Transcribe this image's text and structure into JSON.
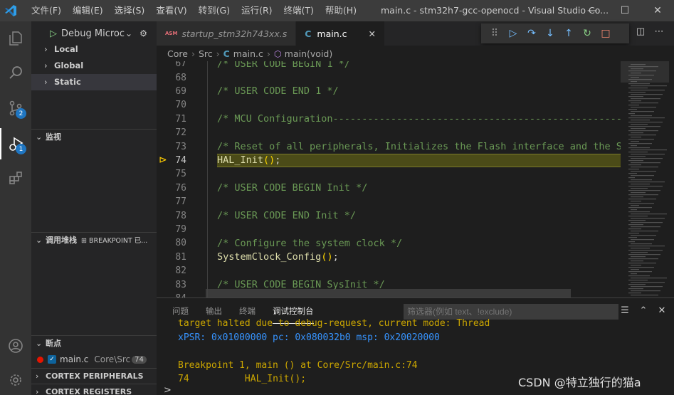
{
  "titlebar": {
    "menu": [
      "文件(F)",
      "编辑(E)",
      "选择(S)",
      "查看(V)",
      "转到(G)",
      "运行(R)",
      "终端(T)",
      "帮助(H)"
    ],
    "title": "main.c - stm32h7-gcc-openocd - Visual Studio Co...",
    "controls": [
      "—",
      "☐",
      "✕"
    ]
  },
  "activity": {
    "scm_badge": "2",
    "debug_badge": "1"
  },
  "sidebar": {
    "debug_config": "Debug Microc",
    "variables": [
      "Local",
      "Global",
      "Static"
    ],
    "watch_header": "监视",
    "callstack_header": "调用堆栈",
    "callstack_status": "⊞ BREAKPOINT 已...",
    "breakpoints_header": "断点",
    "breakpoint": {
      "file": "main.c",
      "path": "Core\\Src",
      "line": "74"
    },
    "extra_sections": [
      "CORTEX PERIPHERALS",
      "CORTEX REGISTERS"
    ]
  },
  "tabs": [
    {
      "label": "startup_stm32h743xx.s",
      "icon": "ASM"
    },
    {
      "label": "main.c",
      "icon": "C"
    }
  ],
  "debug_toolbar": [
    "grip-icon",
    "continue-icon",
    "step-over-icon",
    "step-into-icon",
    "step-out-icon",
    "restart-icon",
    "stop-icon"
  ],
  "breadcrumb": {
    "parts": [
      "Core",
      "Src",
      "main.c",
      "main(void)"
    ]
  },
  "editor": {
    "current_line": 74,
    "lines": [
      {
        "n": "67",
        "parts": [
          {
            "t": "/* USER CODE BEGIN 1 */",
            "c": "cm"
          }
        ]
      },
      {
        "n": "68",
        "parts": []
      },
      {
        "n": "69",
        "parts": [
          {
            "t": "/* USER CODE END 1 */",
            "c": "cm"
          }
        ]
      },
      {
        "n": "70",
        "parts": []
      },
      {
        "n": "71",
        "parts": [
          {
            "t": "/* MCU Configuration--------------------------------------------------------",
            "c": "cm"
          }
        ]
      },
      {
        "n": "72",
        "parts": []
      },
      {
        "n": "73",
        "parts": [
          {
            "t": "/* Reset of all peripherals, Initializes the Flash interface and the Systick. */",
            "c": "cm"
          }
        ]
      },
      {
        "n": "74",
        "parts": [
          {
            "t": "HAL_Init",
            "c": "fn"
          },
          {
            "t": "()",
            "c": "pn"
          },
          {
            "t": ";",
            "c": "tx"
          }
        ]
      },
      {
        "n": "75",
        "parts": []
      },
      {
        "n": "76",
        "parts": [
          {
            "t": "/* USER CODE BEGIN Init */",
            "c": "cm"
          }
        ]
      },
      {
        "n": "77",
        "parts": []
      },
      {
        "n": "78",
        "parts": [
          {
            "t": "/* USER CODE END Init */",
            "c": "cm"
          }
        ]
      },
      {
        "n": "79",
        "parts": []
      },
      {
        "n": "80",
        "parts": [
          {
            "t": "/* Configure the system clock */",
            "c": "cm"
          }
        ]
      },
      {
        "n": "81",
        "parts": [
          {
            "t": "SystemClock_Config",
            "c": "fn"
          },
          {
            "t": "()",
            "c": "pn"
          },
          {
            "t": ";",
            "c": "tx"
          }
        ]
      },
      {
        "n": "82",
        "parts": []
      },
      {
        "n": "83",
        "parts": [
          {
            "t": "/* USER CODE BEGIN SysInit */",
            "c": "cm"
          }
        ]
      },
      {
        "n": "84",
        "parts": []
      }
    ]
  },
  "panel": {
    "tabs": [
      "问题",
      "输出",
      "终端",
      "调试控制台"
    ],
    "filter_placeholder": "筛选器(例如 text、!exclude)",
    "lines": [
      {
        "t": "target halted due to debug-request, current mode: Thread",
        "c": ""
      },
      {
        "t": "xPSR: 0x01000000 pc: 0x080032b0 msp: 0x20020000",
        "c": "blue"
      },
      {
        "t": "",
        "c": ""
      },
      {
        "t": "Breakpoint 1, main () at Core/Src/main.c:74",
        "c": ""
      },
      {
        "t": "74\t    HAL_Init();",
        "c": ""
      }
    ],
    "prompt": ">"
  },
  "watermark": "CSDN @特立独行的猫a",
  "colors": {
    "accent": "#007acc",
    "highlight_line": "#4b4b18",
    "breakpoint": "#e51400",
    "comment": "#6a9955",
    "function": "#dcdcaa"
  }
}
